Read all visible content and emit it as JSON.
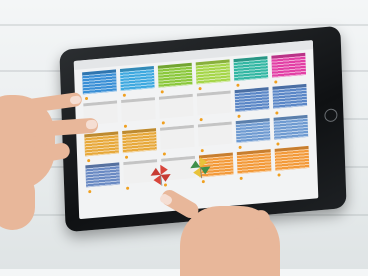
{
  "scene": {
    "description_label": "",
    "tablet": {
      "topbar_left": "",
      "topbar_right": ""
    },
    "tiles": [
      {
        "color": "#3a8fd6"
      },
      {
        "color": "#3fa9e0"
      },
      {
        "color": "#8bc83c"
      },
      {
        "color": "#a6d64a"
      },
      {
        "color": "#33b7a3"
      },
      {
        "color": "#e23fa5"
      },
      {
        "color": "#f0f0f0"
      },
      {
        "color": "#f0f0f0"
      },
      {
        "color": "#f0f0f0"
      },
      {
        "color": "#f0f0f0"
      },
      {
        "color": "#5b87c7"
      },
      {
        "color": "#5b87c7"
      },
      {
        "color": "#e7a93b"
      },
      {
        "color": "#e7a93b"
      },
      {
        "color": "#f0f0f0"
      },
      {
        "color": "#f0f0f0"
      },
      {
        "color": "#6f9bd1"
      },
      {
        "color": "#6f9bd1"
      },
      {
        "color": "#6a8ac3"
      },
      {
        "color": "#f0f0f0"
      },
      {
        "color": "#f0f0f0"
      },
      {
        "color": "#f39a3a"
      },
      {
        "color": "#f39a3a"
      },
      {
        "color": "#f39a3a"
      }
    ],
    "colors": {
      "accent_orange": "#f0a020",
      "tablet_frame": "#111315",
      "skin": "#e8b79a"
    }
  }
}
